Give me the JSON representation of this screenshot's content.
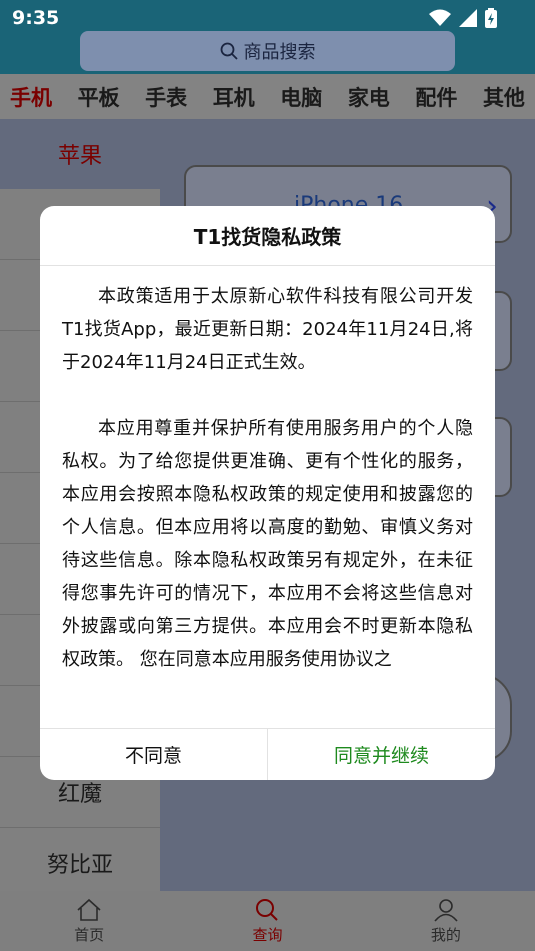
{
  "status_bar": {
    "time": "9:35"
  },
  "search": {
    "label": "商品搜索",
    "icon": "search-icon"
  },
  "tabs": [
    {
      "label": "手机",
      "active": true
    },
    {
      "label": "平板"
    },
    {
      "label": "手表"
    },
    {
      "label": "耳机"
    },
    {
      "label": "电脑"
    },
    {
      "label": "家电"
    },
    {
      "label": "配件"
    },
    {
      "label": "其他"
    }
  ],
  "brands": {
    "active": "苹果",
    "visible": [
      "红魔",
      "努比亚"
    ]
  },
  "models": {
    "first": "iPhone 16"
  },
  "dialog": {
    "title": "T1找货隐私政策",
    "paragraphs": [
      "本政策适用于太原新心软件科技有限公司开发T1找货App，最近更新日期：2024年11月24日,将于2024年11月24日正式生效。",
      "本应用尊重并保护所有使用服务用户的个人隐私权。为了给您提供更准确、更有个性化的服务，本应用会按照本隐私权政策的规定使用和披露您的个人信息。但本应用将以高度的勤勉、审慎义务对待这些信息。除本隐私权政策另有规定外，在未征得您事先许可的情况下，本应用不会将这些信息对外披露或向第三方提供。本应用会不时更新本隐私权政策。 您在同意本应用服务使用协议之"
    ],
    "decline_label": "不同意",
    "agree_label": "同意并继续"
  },
  "bottom_nav": [
    {
      "label": "首页",
      "icon": "home-icon"
    },
    {
      "label": "查询",
      "icon": "search-icon",
      "active": true
    },
    {
      "label": "我的",
      "icon": "user-icon"
    }
  ],
  "colors": {
    "header": "#1a6477",
    "agree": "#1e8a1e",
    "active_tab": "#c00000"
  }
}
